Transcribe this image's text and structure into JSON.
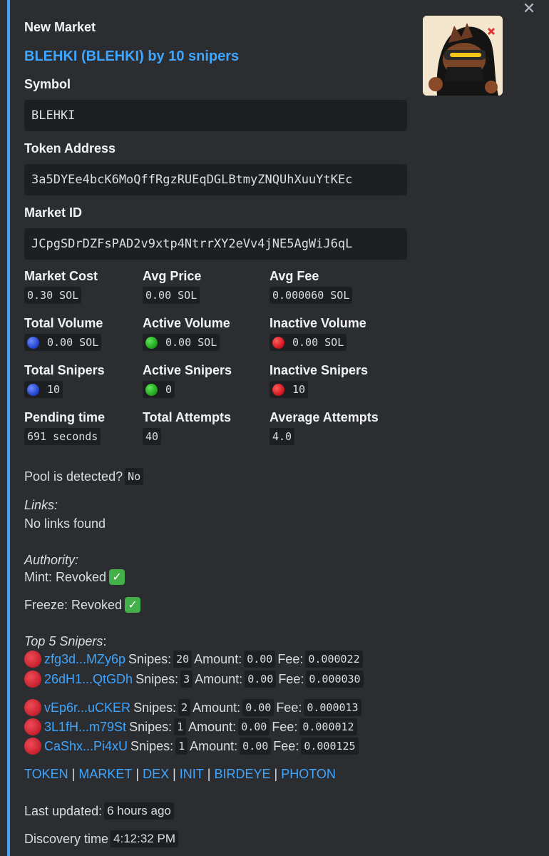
{
  "close_label": "✕",
  "author": "New Market",
  "title": "BLEHKI (BLEHKI) by 10 snipers",
  "fields": {
    "symbol": {
      "label": "Symbol",
      "value": "BLEHKI"
    },
    "token_address": {
      "label": "Token Address",
      "value": "3a5DYEe4bcK6MoQffRgzRUEqDGLBtmyZNQUhXuuYtKEc"
    },
    "market_id": {
      "label": "Market ID",
      "value": "JCpgSDrDZFsPAD2v9xtp4NtrrXY2eVv4jNE5AgWiJ6qL"
    }
  },
  "stats": {
    "market_cost": {
      "label": "Market Cost",
      "value": "0.30 SOL"
    },
    "avg_price": {
      "label": "Avg Price",
      "value": "0.00 SOL"
    },
    "avg_fee": {
      "label": "Avg Fee",
      "value": "0.000060 SOL"
    },
    "total_volume": {
      "label": "Total Volume",
      "value": "0.00 SOL",
      "dot": "blue"
    },
    "active_volume": {
      "label": "Active Volume",
      "value": "0.00 SOL",
      "dot": "green"
    },
    "inactive_volume": {
      "label": "Inactive Volume",
      "value": "0.00 SOL",
      "dot": "red"
    },
    "total_snipers": {
      "label": "Total Snipers",
      "value": "10",
      "dot": "blue"
    },
    "active_snipers": {
      "label": "Active Snipers",
      "value": "0",
      "dot": "green"
    },
    "inactive_snipers": {
      "label": "Inactive Snipers",
      "value": "10",
      "dot": "red"
    },
    "pending_time": {
      "label": "Pending time",
      "value": "691 seconds"
    },
    "total_attempts": {
      "label": "Total Attempts",
      "value": "40"
    },
    "average_attempts": {
      "label": "Average Attempts",
      "value": "4.0"
    }
  },
  "pool": {
    "label": "Pool is detected?",
    "value": "No"
  },
  "links": {
    "label": "Links:",
    "value": "No links found"
  },
  "authority": {
    "label": "Authority:",
    "mint": "Mint: Revoked",
    "freeze": "Freeze: Revoked"
  },
  "top_snipers": {
    "label": "Top 5 Snipers",
    "snipes_label": "Snipes:",
    "amount_label": "Amount:",
    "fee_label": "Fee:",
    "rows": [
      {
        "addr": "zfg3d...MZy6p",
        "snipes": "20",
        "amount": "0.00",
        "fee": "0.000022"
      },
      {
        "addr": "26dH1...QtGDh",
        "snipes": "3",
        "amount": "0.00",
        "fee": "0.000030"
      },
      {
        "addr": "vEp6r...uCKER",
        "snipes": "2",
        "amount": "0.00",
        "fee": "0.000013"
      },
      {
        "addr": "3L1fH...m79St",
        "snipes": "1",
        "amount": "0.00",
        "fee": "0.000012"
      },
      {
        "addr": "CaShx...Pi4xU",
        "snipes": "1",
        "amount": "0.00",
        "fee": "0.000125"
      }
    ]
  },
  "nav_links": [
    "TOKEN",
    "MARKET",
    "DEX",
    "INIT",
    "BIRDEYE",
    "PHOTON"
  ],
  "nav_separator": "|",
  "last_updated": {
    "label": "Last updated:",
    "value": "6 hours ago"
  },
  "discovery_time": {
    "label": "Discovery time",
    "value": "4:12:32 PM"
  },
  "colors": {
    "accent": "#4a9ff5",
    "link": "#3ea6ff",
    "background": "#2b2d31",
    "code_bg": "#1e1f22"
  }
}
